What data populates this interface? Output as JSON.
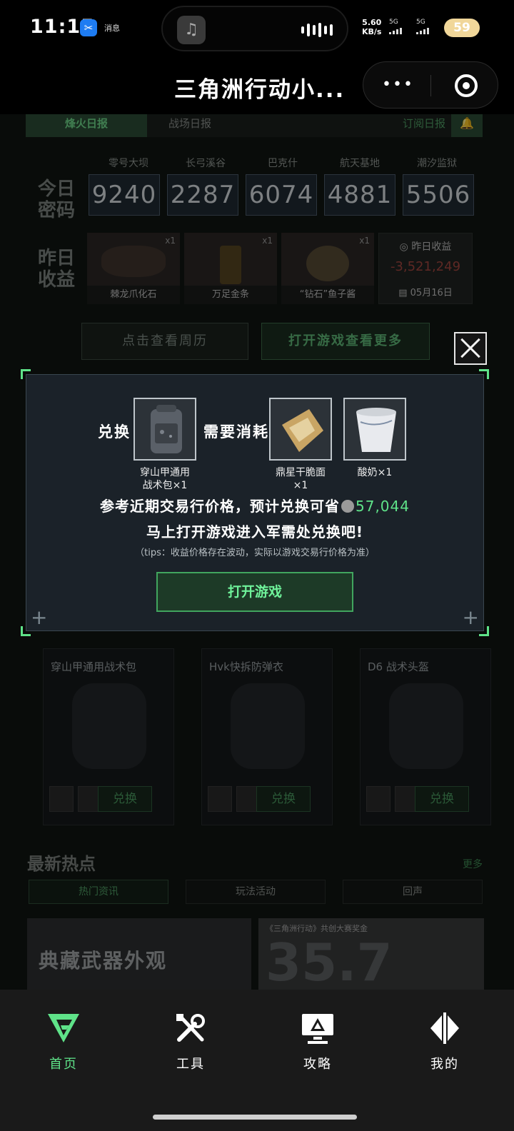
{
  "status_bar": {
    "time": "11:15",
    "notification_text": "消息",
    "network_speed": "5.60",
    "network_unit": "KB/s",
    "signal1": "5G",
    "signal2": "5G",
    "battery": "59"
  },
  "titlebar": {
    "title": "三角洲行动小...",
    "more_label": "•••"
  },
  "page": {
    "tabs": [
      "烽火日报",
      "战场日报",
      "订阅日报"
    ],
    "codes_label": "今日\n密码",
    "income_label": "昨日\n收益",
    "maps": [
      {
        "name": "零号大坝",
        "code": "9240"
      },
      {
        "name": "长弓溪谷",
        "code": "2287"
      },
      {
        "name": "巴克什",
        "code": "6074"
      },
      {
        "name": "航天基地",
        "code": "4881"
      },
      {
        "name": "潮汐监狱",
        "code": "5506"
      }
    ],
    "income_items": [
      {
        "name": "棘龙爪化石",
        "count": "x1"
      },
      {
        "name": "万足金条",
        "count": "x1"
      },
      {
        "name": "“钻石”鱼子酱",
        "count": "x1"
      }
    ],
    "income_total": {
      "label": "昨日收益",
      "value": "-3,521,249",
      "date": "05月16日"
    },
    "week_button": "点击查看周历",
    "more_button": "打开游戏查看更多",
    "cards": [
      {
        "name": "穿山甲通用战术包",
        "button": "兑换"
      },
      {
        "name": "Hvk快拆防弹衣",
        "button": "兑换"
      },
      {
        "name": "D6 战术头盔",
        "button": "兑换"
      }
    ],
    "hot_title": "最新热点",
    "hot_more": "更多",
    "hot_tabs": [
      "热门资讯",
      "玩法活动",
      "回声"
    ],
    "banner1_title": "典藏武器外观",
    "banner2_caption": "《三角洲行动》共创大赛奖金",
    "banner2_big": "35.7"
  },
  "modal": {
    "exchange_label": "兑换",
    "cost_label": "需要消耗",
    "target_item": {
      "name": "穿山甲通用\n战术包×1"
    },
    "cost_items": [
      {
        "name": "鼎星干脆面\n×1",
        "icon": "noodle-pack-icon"
      },
      {
        "name": "酸奶×1",
        "icon": "yogurt-cup-icon"
      }
    ],
    "price_line_prefix": "参考近期交易行价格，预计兑换可省",
    "price_saving": "57,044",
    "call_to_action": "马上打开游戏进入军需处兑换吧!",
    "tips": "（tips：收益价格存在波动，实际以游戏交易行价格为准）",
    "open_button": "打开游戏"
  },
  "bottom_nav": [
    {
      "label": "首页",
      "icon": "home-logo-icon",
      "active": true
    },
    {
      "label": "工具",
      "icon": "tools-icon",
      "active": false
    },
    {
      "label": "攻略",
      "icon": "guide-monitor-icon",
      "active": false
    },
    {
      "label": "我的",
      "icon": "profile-icon",
      "active": false
    }
  ],
  "colors": {
    "accent": "#5fe389",
    "modal_bg": "#1b2229",
    "loss": "#a2463f"
  }
}
